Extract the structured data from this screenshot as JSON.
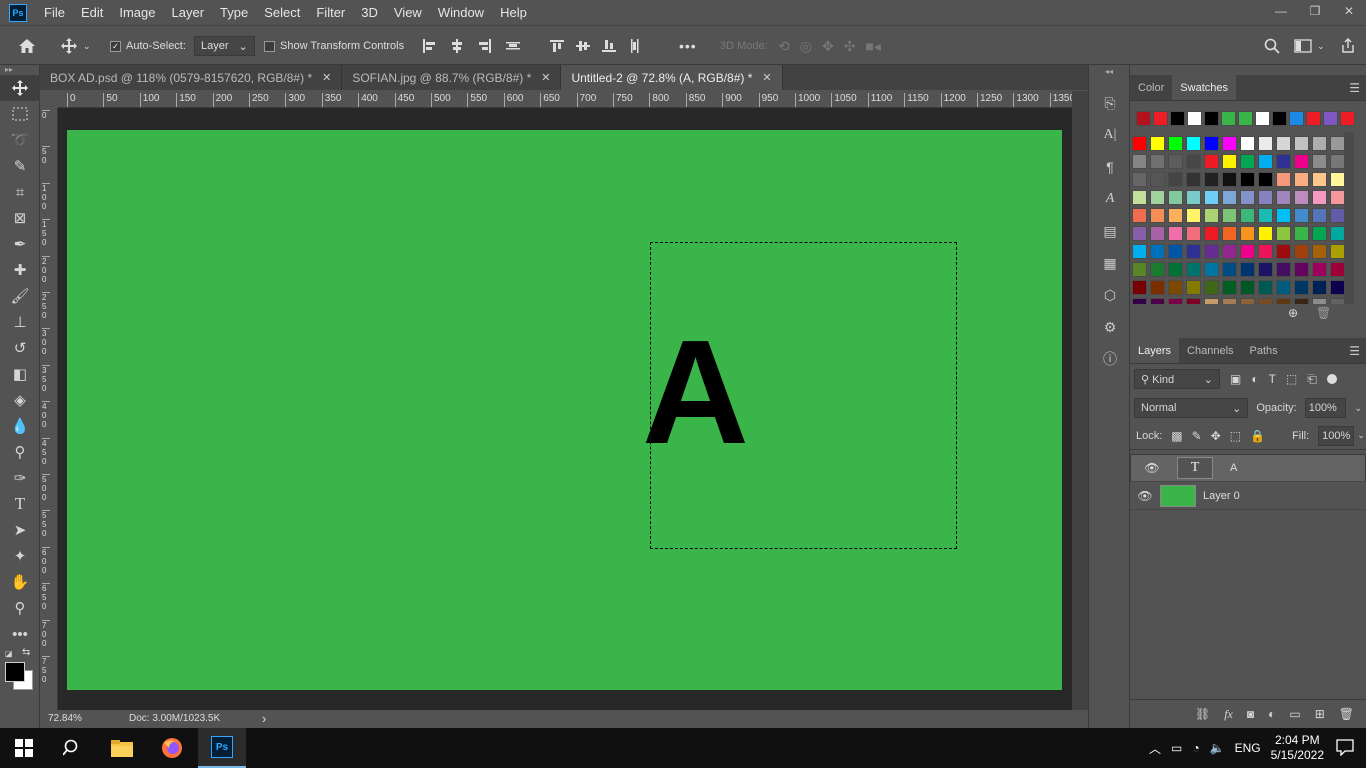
{
  "app": {
    "logo": "Ps",
    "accent": "#31a8ff"
  },
  "menu": [
    "File",
    "Edit",
    "Image",
    "Layer",
    "Type",
    "Select",
    "Filter",
    "3D",
    "View",
    "Window",
    "Help"
  ],
  "window_controls": {
    "minimize": "—",
    "restore": "❐",
    "close": "✕"
  },
  "options": {
    "auto_select_label": "Auto-Select:",
    "auto_select_value": "Layer",
    "show_transform_label": "Show Transform Controls",
    "mode_3d_label": "3D Mode:",
    "more": "•••"
  },
  "tabs": [
    {
      "title": "BOX AD.psd @ 118% (0579-8157620, RGB/8#) *",
      "close": "✕"
    },
    {
      "title": "SOFIAN.jpg @ 88.7% (RGB/8#) *",
      "close": "✕"
    },
    {
      "title": "Untitled-2 @ 72.8% (A, RGB/8#) *",
      "close": "✕"
    }
  ],
  "ruler_h": [
    "0",
    "50",
    "100",
    "150",
    "200",
    "250",
    "300",
    "350",
    "400",
    "450",
    "500",
    "550",
    "600",
    "650",
    "700",
    "750",
    "800",
    "850",
    "900",
    "950",
    "1000",
    "1050",
    "1100",
    "1150",
    "1200",
    "1250",
    "1300",
    "1350"
  ],
  "ruler_v": [
    "0",
    "5 0",
    "1 0 0",
    "1 5 0",
    "2 0 0",
    "2 5 0",
    "3 0 0",
    "3 5 0",
    "4 0 0",
    "4 5 0",
    "5 0 0",
    "5 5 0",
    "6 0 0",
    "6 5 0",
    "7 0 0",
    "7 5 0"
  ],
  "canvas": {
    "background": "#39b54a",
    "text": "A"
  },
  "status": {
    "zoom": "72.84%",
    "doc": "Doc: 3.00M/1023.5K",
    "arrow": "›"
  },
  "color_panel": {
    "tab_color": "Color",
    "tab_swatches": "Swatches"
  },
  "recent_swatches": [
    "#b1121b",
    "#ee1c24",
    "#000000",
    "#ffffff",
    "#000000",
    "#39b54a",
    "#39b54a",
    "#ffffff",
    "#000000",
    "#1e88e5",
    "#ee1c24",
    "#7e57c2",
    "#ee1c24"
  ],
  "swatch_grid": [
    [
      "#ff0000",
      "#ffff00",
      "#00ff00",
      "#00ffff",
      "#0000ff",
      "#ff00ff",
      "#ffffff",
      "#ebebeb",
      "#d6d6d6",
      "#c2c2c2",
      "#adadad",
      "#999999"
    ],
    [
      "#858585",
      "#707070",
      "#5c5c5c",
      "#474747",
      "#ed1c24",
      "#fff200",
      "#00a651",
      "#00aeef",
      "#2e3192",
      "#ec008c",
      "#8c8c8c",
      "#777777"
    ],
    [
      "#666666",
      "#555555",
      "#444444",
      "#333333",
      "#222222",
      "#111111",
      "#000000",
      "#000000",
      "#f7977a",
      "#f9ad81",
      "#fdc68a",
      "#fff79a"
    ],
    [
      "#c4df9b",
      "#a3d39c",
      "#82ca9d",
      "#7accc8",
      "#6dcff6",
      "#7da7d9",
      "#8393ca",
      "#8781bd",
      "#a186be",
      "#bd8cbf",
      "#f49ac1",
      "#f5989d"
    ],
    [
      "#f26c4f",
      "#f68e56",
      "#fbaf5d",
      "#fff467",
      "#acd372",
      "#7cc576",
      "#3bb878",
      "#1abbb4",
      "#00bff3",
      "#438ccb",
      "#5574b9",
      "#605ca8"
    ],
    [
      "#855fa8",
      "#a763a8",
      "#f06ea9",
      "#f26d7d",
      "#ed1c24",
      "#f26522",
      "#f7941d",
      "#fff200",
      "#8dc73f",
      "#39b54a",
      "#00a651",
      "#00a99d"
    ],
    [
      "#00aeef",
      "#0072bc",
      "#0054a6",
      "#2e3192",
      "#662d91",
      "#92278f",
      "#ec008c",
      "#ed145b",
      "#9e0b0f",
      "#a0410d",
      "#a3620a",
      "#aba000"
    ],
    [
      "#598527",
      "#197b30",
      "#007236",
      "#00746b",
      "#0076a3",
      "#004b80",
      "#003471",
      "#1b1464",
      "#440e62",
      "#630460",
      "#9e005d",
      "#9e0039"
    ],
    [
      "#790000",
      "#7b2e00",
      "#7d4900",
      "#827b00",
      "#406618",
      "#005e20",
      "#005826",
      "#005952",
      "#005b7f",
      "#003663",
      "#002157",
      "#0d004c"
    ],
    [
      "#32004b",
      "#4b0049",
      "#7b0046",
      "#7a0026",
      "#c69c6d",
      "#a67c52",
      "#8c6239",
      "#754c24",
      "#603913",
      "#3c2415",
      "#8c8c8c",
      "#626262"
    ]
  ],
  "layers_panel": {
    "tab_layers": "Layers",
    "tab_channels": "Channels",
    "tab_paths": "Paths",
    "kind_label": "Kind",
    "blend_mode": "Normal",
    "opacity_label": "Opacity:",
    "opacity_value": "100%",
    "lock_label": "Lock:",
    "fill_label": "Fill:",
    "fill_value": "100%",
    "layers": [
      {
        "name": "A",
        "thumb": "T",
        "selected": true
      },
      {
        "name": "Layer 0",
        "thumb": "",
        "selected": false
      }
    ],
    "bottom_fx": "fx"
  },
  "taskbar": {
    "lang": "ENG",
    "time": "2:04 PM",
    "date": "5/15/2022",
    "ps_label": "Ps"
  }
}
